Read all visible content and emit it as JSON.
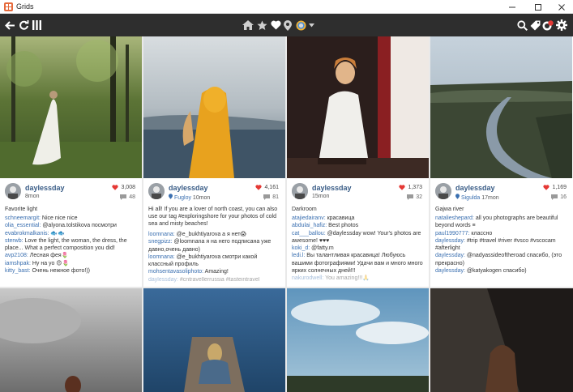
{
  "window": {
    "title": "Grids"
  },
  "toolbar": {
    "left_icons": [
      "back-arrow-icon",
      "refresh-icon",
      "columns-icon"
    ],
    "center_icons": [
      "home-icon",
      "star-icon",
      "heart-icon",
      "location-pin-icon",
      "profile-circle-icon",
      "dropdown-caret-icon"
    ],
    "right_icons": [
      "search-icon",
      "tag-icon",
      "notifications-icon",
      "settings-icon"
    ],
    "badge_color": "#e53935"
  },
  "colors": {
    "toolbar_bg": "#2e2e2e",
    "username": "#3a5d87",
    "link": "#3a6fb0",
    "heart": "#e53935"
  },
  "posts": [
    {
      "username": "daylessday",
      "location": "",
      "age": "8mon",
      "likes": "3,008",
      "comments": "48",
      "caption": "Favorite light",
      "comment_list": [
        {
          "user": "schneemargit:",
          "text": " Nice nice nice"
        },
        {
          "user": "olia_essential:",
          "text": " @alyona.tolstikova посмотри"
        },
        {
          "user": "evabrokmalkanis:",
          "text": " 🐟🐟"
        },
        {
          "user": "sterwb:",
          "text": " Love the light, the woman, the dress, the place... What a perfect composition you did!"
        },
        {
          "user": "avp2108:",
          "text": " Лесная фея🌷"
        },
        {
          "user": "iamshpak:",
          "text": " Ну на уо 😍🌷"
        },
        {
          "user": "kitty_bast:",
          "text": " Очень нежное фото!))"
        }
      ]
    },
    {
      "username": "daylessday",
      "location": "Fugloy",
      "age": "10mon",
      "likes": "4,161",
      "comments": "81",
      "caption": "Hi all! If you are a lover of north coast, you can also use our tag #exploringshore for your photos of cold sea and misty beaches!",
      "comment_list": [
        {
          "user": "loomnana:",
          "text": " @e_bukhtiyarova а я нет😱"
        },
        {
          "user": "snegpizz:",
          "text": " @loomnana я на него подписана уже давно,очень давно)"
        },
        {
          "user": "loomnana:",
          "text": " @e_bukhtiyarova смотри какой классный профиль"
        },
        {
          "user": "mohsentavasoliphoto:",
          "text": " Amazing!"
        },
        {
          "user": "daylessday:",
          "text": " #cntravellerrussia #tasteintravel",
          "faded": true
        }
      ]
    },
    {
      "username": "daylessday",
      "location": "",
      "age": "15mon",
      "likes": "1,373",
      "comments": "32",
      "caption": "Darkroom",
      "comment_list": [
        {
          "user": "atajiedairanv:",
          "text": " красавица"
        },
        {
          "user": "abdulai_hafiz:",
          "text": " Best photos"
        },
        {
          "user": "cat___ballou:",
          "text": " @daylessday wow! Your's photos are awesome! ♥♥♥"
        },
        {
          "user": "koki_d:",
          "text": " @fatty.m"
        },
        {
          "user": "ledi.l:",
          "text": " Вы талантливая красавица! Любуюсь вашими фотографиями! Удачи вам и много много ярких солнечных дней!!!"
        },
        {
          "user": "nakurodwell:",
          "text": " You amazing!!!🙏",
          "faded": true
        }
      ]
    },
    {
      "username": "daylessday",
      "location": "Sigulda",
      "age": "17mon",
      "likes": "1,169",
      "comments": "16",
      "caption": "Gajwa river",
      "comment_list": [
        {
          "user": "natalieshepard:",
          "text": " all you photographs are beautiful beyond words ≡"
        },
        {
          "user": "paul1990777:",
          "text": " классно"
        },
        {
          "user": "daylessday:",
          "text": " #trip #travel #river #vsco #vscocam #afterlight"
        },
        {
          "user": "daylessday:",
          "text": " @nadyassideoftheroad спасибо, (это прекрасно)"
        },
        {
          "user": "daylessday:",
          "text": " @katyakogen спасибо)"
        }
      ]
    }
  ]
}
